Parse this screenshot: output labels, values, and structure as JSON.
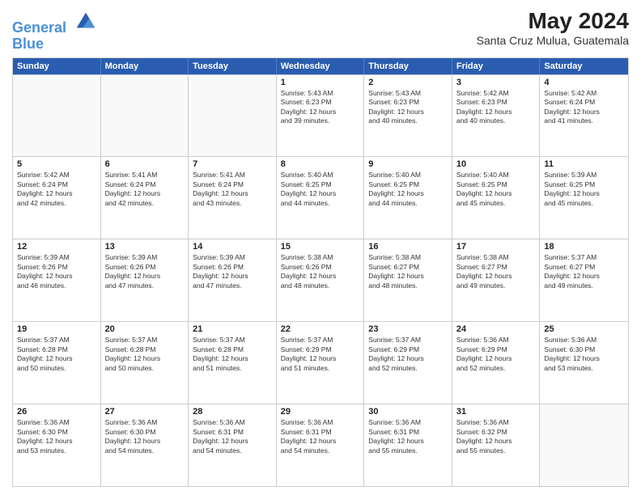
{
  "header": {
    "logo_line1": "General",
    "logo_line2": "Blue",
    "month_year": "May 2024",
    "location": "Santa Cruz Mulua, Guatemala"
  },
  "weekdays": [
    "Sunday",
    "Monday",
    "Tuesday",
    "Wednesday",
    "Thursday",
    "Friday",
    "Saturday"
  ],
  "weeks": [
    [
      {
        "day": "",
        "info": ""
      },
      {
        "day": "",
        "info": ""
      },
      {
        "day": "",
        "info": ""
      },
      {
        "day": "1",
        "info": "Sunrise: 5:43 AM\nSunset: 6:23 PM\nDaylight: 12 hours\nand 39 minutes."
      },
      {
        "day": "2",
        "info": "Sunrise: 5:43 AM\nSunset: 6:23 PM\nDaylight: 12 hours\nand 40 minutes."
      },
      {
        "day": "3",
        "info": "Sunrise: 5:42 AM\nSunset: 6:23 PM\nDaylight: 12 hours\nand 40 minutes."
      },
      {
        "day": "4",
        "info": "Sunrise: 5:42 AM\nSunset: 6:24 PM\nDaylight: 12 hours\nand 41 minutes."
      }
    ],
    [
      {
        "day": "5",
        "info": "Sunrise: 5:42 AM\nSunset: 6:24 PM\nDaylight: 12 hours\nand 42 minutes."
      },
      {
        "day": "6",
        "info": "Sunrise: 5:41 AM\nSunset: 6:24 PM\nDaylight: 12 hours\nand 42 minutes."
      },
      {
        "day": "7",
        "info": "Sunrise: 5:41 AM\nSunset: 6:24 PM\nDaylight: 12 hours\nand 43 minutes."
      },
      {
        "day": "8",
        "info": "Sunrise: 5:40 AM\nSunset: 6:25 PM\nDaylight: 12 hours\nand 44 minutes."
      },
      {
        "day": "9",
        "info": "Sunrise: 5:40 AM\nSunset: 6:25 PM\nDaylight: 12 hours\nand 44 minutes."
      },
      {
        "day": "10",
        "info": "Sunrise: 5:40 AM\nSunset: 6:25 PM\nDaylight: 12 hours\nand 45 minutes."
      },
      {
        "day": "11",
        "info": "Sunrise: 5:39 AM\nSunset: 6:25 PM\nDaylight: 12 hours\nand 45 minutes."
      }
    ],
    [
      {
        "day": "12",
        "info": "Sunrise: 5:39 AM\nSunset: 6:26 PM\nDaylight: 12 hours\nand 46 minutes."
      },
      {
        "day": "13",
        "info": "Sunrise: 5:39 AM\nSunset: 6:26 PM\nDaylight: 12 hours\nand 47 minutes."
      },
      {
        "day": "14",
        "info": "Sunrise: 5:39 AM\nSunset: 6:26 PM\nDaylight: 12 hours\nand 47 minutes."
      },
      {
        "day": "15",
        "info": "Sunrise: 5:38 AM\nSunset: 6:26 PM\nDaylight: 12 hours\nand 48 minutes."
      },
      {
        "day": "16",
        "info": "Sunrise: 5:38 AM\nSunset: 6:27 PM\nDaylight: 12 hours\nand 48 minutes."
      },
      {
        "day": "17",
        "info": "Sunrise: 5:38 AM\nSunset: 6:27 PM\nDaylight: 12 hours\nand 49 minutes."
      },
      {
        "day": "18",
        "info": "Sunrise: 5:37 AM\nSunset: 6:27 PM\nDaylight: 12 hours\nand 49 minutes."
      }
    ],
    [
      {
        "day": "19",
        "info": "Sunrise: 5:37 AM\nSunset: 6:28 PM\nDaylight: 12 hours\nand 50 minutes."
      },
      {
        "day": "20",
        "info": "Sunrise: 5:37 AM\nSunset: 6:28 PM\nDaylight: 12 hours\nand 50 minutes."
      },
      {
        "day": "21",
        "info": "Sunrise: 5:37 AM\nSunset: 6:28 PM\nDaylight: 12 hours\nand 51 minutes."
      },
      {
        "day": "22",
        "info": "Sunrise: 5:37 AM\nSunset: 6:29 PM\nDaylight: 12 hours\nand 51 minutes."
      },
      {
        "day": "23",
        "info": "Sunrise: 5:37 AM\nSunset: 6:29 PM\nDaylight: 12 hours\nand 52 minutes."
      },
      {
        "day": "24",
        "info": "Sunrise: 5:36 AM\nSunset: 6:29 PM\nDaylight: 12 hours\nand 52 minutes."
      },
      {
        "day": "25",
        "info": "Sunrise: 5:36 AM\nSunset: 6:30 PM\nDaylight: 12 hours\nand 53 minutes."
      }
    ],
    [
      {
        "day": "26",
        "info": "Sunrise: 5:36 AM\nSunset: 6:30 PM\nDaylight: 12 hours\nand 53 minutes."
      },
      {
        "day": "27",
        "info": "Sunrise: 5:36 AM\nSunset: 6:30 PM\nDaylight: 12 hours\nand 54 minutes."
      },
      {
        "day": "28",
        "info": "Sunrise: 5:36 AM\nSunset: 6:31 PM\nDaylight: 12 hours\nand 54 minutes."
      },
      {
        "day": "29",
        "info": "Sunrise: 5:36 AM\nSunset: 6:31 PM\nDaylight: 12 hours\nand 54 minutes."
      },
      {
        "day": "30",
        "info": "Sunrise: 5:36 AM\nSunset: 6:31 PM\nDaylight: 12 hours\nand 55 minutes."
      },
      {
        "day": "31",
        "info": "Sunrise: 5:36 AM\nSunset: 6:32 PM\nDaylight: 12 hours\nand 55 minutes."
      },
      {
        "day": "",
        "info": ""
      }
    ]
  ]
}
